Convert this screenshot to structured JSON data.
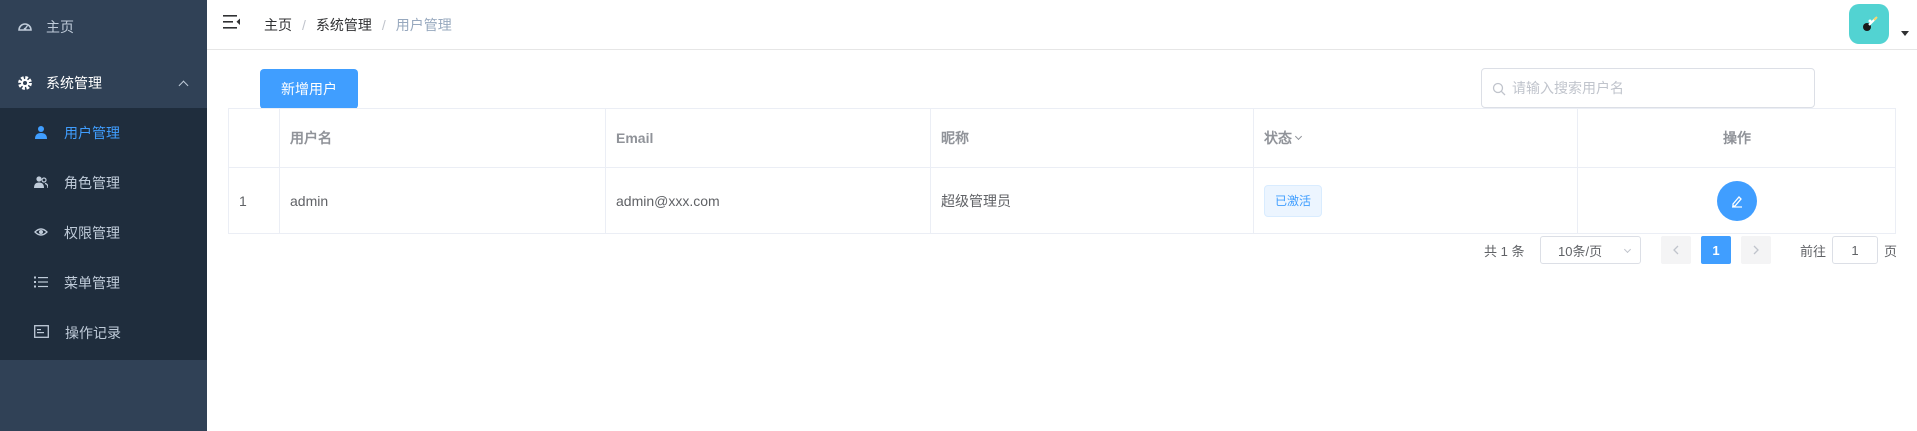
{
  "sidebar": {
    "home": "主页",
    "system": "系统管理",
    "items": [
      {
        "label": "用户管理",
        "icon": "user-icon"
      },
      {
        "label": "角色管理",
        "icon": "users-icon"
      },
      {
        "label": "权限管理",
        "icon": "eye-icon"
      },
      {
        "label": "菜单管理",
        "icon": "list-icon"
      },
      {
        "label": "操作记录",
        "icon": "record-icon"
      }
    ]
  },
  "header": {
    "breadcrumb": [
      "主页",
      "系统管理",
      "用户管理"
    ],
    "separator": "/"
  },
  "toolbar": {
    "add_label": "新增用户",
    "search_placeholder": "请输入搜索用户名"
  },
  "table": {
    "columns": [
      "",
      "用户名",
      "Email",
      "昵称",
      "状态",
      "操作"
    ],
    "rows": [
      {
        "index": "1",
        "username": "admin",
        "email": "admin@xxx.com",
        "nickname": "超级管理员",
        "status": "已激活"
      }
    ]
  },
  "pagination": {
    "total": "共 1 条",
    "page_size": "10条/页",
    "current_page": "1",
    "goto_prefix": "前往",
    "goto_value": "1",
    "goto_suffix": "页"
  },
  "colors": {
    "sidebar": "#304156",
    "submenu": "#1f2d3d",
    "accent": "#409eff"
  }
}
